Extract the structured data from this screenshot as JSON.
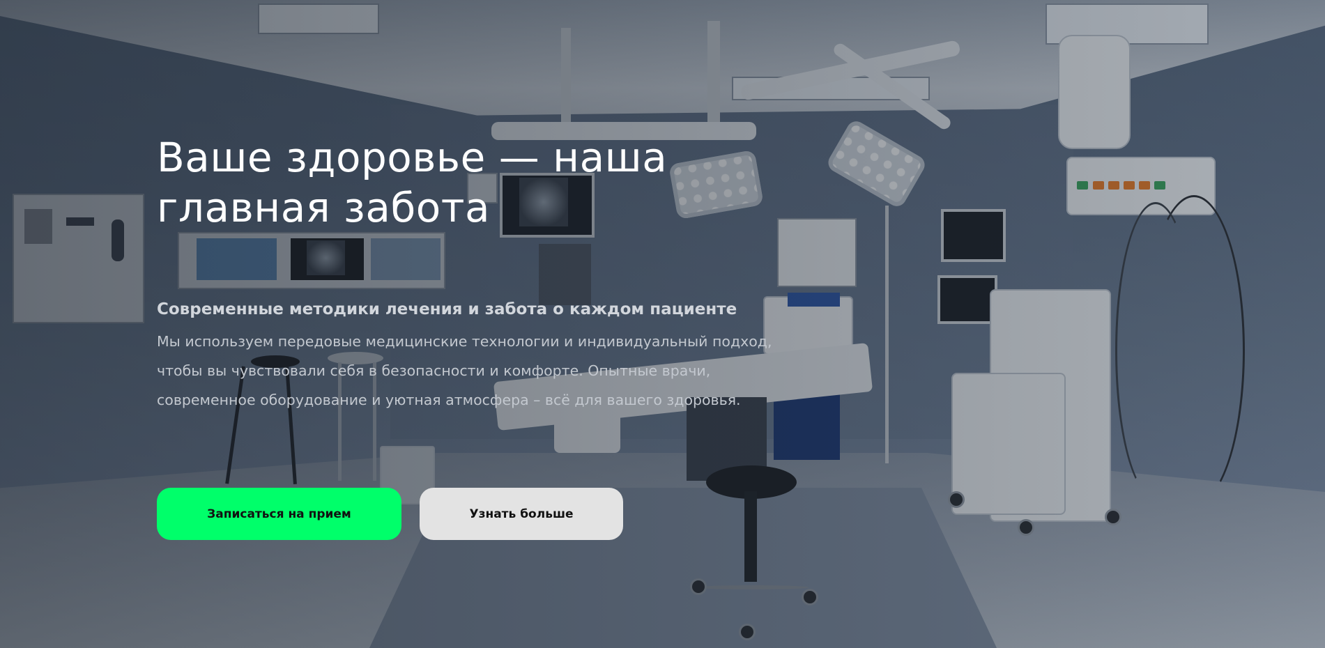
{
  "hero": {
    "title_line1": "Ваше здоровье — наша",
    "title_line2": "главная забота",
    "subtitle": "Современные методики лечения и забота о каждом пациенте",
    "description_lines": [
      "Мы используем передовые медицинские технологии и индивидуальный подход,",
      "чтобы вы чувствовали себя в безопасности и комфорте. Опытные врачи,",
      "современное оборудование и уютная атмосфера – всё для вашего здоровья."
    ],
    "background_image": "operating-room-photo"
  },
  "buttons": {
    "primary_label": "Записаться на прием",
    "secondary_label": "Узнать больше"
  },
  "colors": {
    "primary_button": "#00ff6a",
    "secondary_button": "#e3e3e3",
    "title_text": "#ffffff"
  }
}
